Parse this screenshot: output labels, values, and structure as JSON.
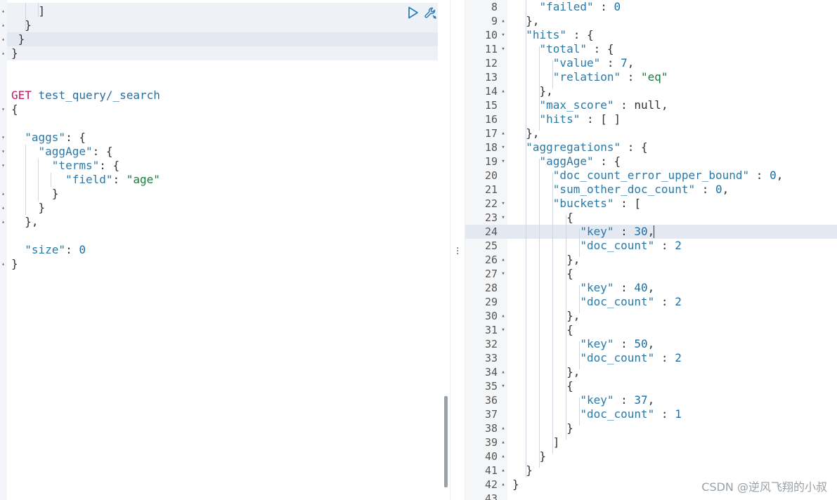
{
  "request_editor": {
    "lines": [
      {
        "tokens": [
          {
            "t": "    ]",
            "c": "p"
          }
        ],
        "fold": "▴"
      },
      {
        "tokens": [
          {
            "t": "  }",
            "c": "p"
          }
        ],
        "fold": "▴"
      },
      {
        "tokens": [
          {
            "t": " }",
            "c": "p"
          }
        ],
        "fold": "▴"
      },
      {
        "tokens": [
          {
            "t": "}",
            "c": "p"
          }
        ],
        "fold": "▴"
      },
      {
        "tokens": [],
        "fold": ""
      },
      {
        "tokens": [],
        "fold": ""
      },
      {
        "tokens": [
          {
            "t": "GET",
            "c": "m"
          },
          {
            "t": " test_query/_search",
            "c": "u"
          }
        ],
        "fold": ""
      },
      {
        "tokens": [
          {
            "t": "{",
            "c": "p"
          }
        ],
        "fold": "▾"
      },
      {
        "tokens": [],
        "fold": ""
      },
      {
        "tokens": [
          {
            "t": "  ",
            "c": "p"
          },
          {
            "t": "\"aggs\"",
            "c": "k"
          },
          {
            "t": ": {",
            "c": "p"
          }
        ],
        "fold": "▾"
      },
      {
        "tokens": [
          {
            "t": "    ",
            "c": "p"
          },
          {
            "t": "\"aggAge\"",
            "c": "k"
          },
          {
            "t": ": {",
            "c": "p"
          }
        ],
        "fold": "▾"
      },
      {
        "tokens": [
          {
            "t": "      ",
            "c": "p"
          },
          {
            "t": "\"terms\"",
            "c": "k"
          },
          {
            "t": ": {",
            "c": "p"
          }
        ],
        "fold": "▾"
      },
      {
        "tokens": [
          {
            "t": "        ",
            "c": "p"
          },
          {
            "t": "\"field\"",
            "c": "k"
          },
          {
            "t": ": ",
            "c": "p"
          },
          {
            "t": "\"age\"",
            "c": "s"
          }
        ],
        "fold": ""
      },
      {
        "tokens": [
          {
            "t": "      }",
            "c": "p"
          }
        ],
        "fold": "▴"
      },
      {
        "tokens": [
          {
            "t": "    }",
            "c": "p"
          }
        ],
        "fold": "▴"
      },
      {
        "tokens": [
          {
            "t": "  },",
            "c": "p"
          }
        ],
        "fold": "▴"
      },
      {
        "tokens": [],
        "fold": ""
      },
      {
        "tokens": [
          {
            "t": "  ",
            "c": "p"
          },
          {
            "t": "\"size\"",
            "c": "k"
          },
          {
            "t": ": ",
            "c": "p"
          },
          {
            "t": "0",
            "c": "n"
          }
        ],
        "fold": ""
      },
      {
        "tokens": [
          {
            "t": "}",
            "c": "p"
          }
        ],
        "fold": "▴"
      }
    ]
  },
  "response_viewer": {
    "lines": [
      {
        "no": "8",
        "fold": "",
        "tokens": [
          {
            "t": "    ",
            "c": "p"
          },
          {
            "t": "\"failed\"",
            "c": "k"
          },
          {
            "t": " : ",
            "c": "p"
          },
          {
            "t": "0",
            "c": "n"
          }
        ]
      },
      {
        "no": "9",
        "fold": "▴",
        "tokens": [
          {
            "t": "  },",
            "c": "p"
          }
        ]
      },
      {
        "no": "10",
        "fold": "▾",
        "tokens": [
          {
            "t": "  ",
            "c": "p"
          },
          {
            "t": "\"hits\"",
            "c": "k"
          },
          {
            "t": " : {",
            "c": "p"
          }
        ]
      },
      {
        "no": "11",
        "fold": "▾",
        "tokens": [
          {
            "t": "    ",
            "c": "p"
          },
          {
            "t": "\"total\"",
            "c": "k"
          },
          {
            "t": " : {",
            "c": "p"
          }
        ]
      },
      {
        "no": "12",
        "fold": "",
        "tokens": [
          {
            "t": "      ",
            "c": "p"
          },
          {
            "t": "\"value\"",
            "c": "k"
          },
          {
            "t": " : ",
            "c": "p"
          },
          {
            "t": "7",
            "c": "n"
          },
          {
            "t": ",",
            "c": "p"
          }
        ]
      },
      {
        "no": "13",
        "fold": "",
        "tokens": [
          {
            "t": "      ",
            "c": "p"
          },
          {
            "t": "\"relation\"",
            "c": "k"
          },
          {
            "t": " : ",
            "c": "p"
          },
          {
            "t": "\"eq\"",
            "c": "s"
          }
        ]
      },
      {
        "no": "14",
        "fold": "▴",
        "tokens": [
          {
            "t": "    },",
            "c": "p"
          }
        ]
      },
      {
        "no": "15",
        "fold": "",
        "tokens": [
          {
            "t": "    ",
            "c": "p"
          },
          {
            "t": "\"max_score\"",
            "c": "k"
          },
          {
            "t": " : ",
            "c": "p"
          },
          {
            "t": "null",
            "c": "nl"
          },
          {
            "t": ",",
            "c": "p"
          }
        ]
      },
      {
        "no": "16",
        "fold": "",
        "tokens": [
          {
            "t": "    ",
            "c": "p"
          },
          {
            "t": "\"hits\"",
            "c": "k"
          },
          {
            "t": " : [ ]",
            "c": "p"
          }
        ]
      },
      {
        "no": "17",
        "fold": "▴",
        "tokens": [
          {
            "t": "  },",
            "c": "p"
          }
        ]
      },
      {
        "no": "18",
        "fold": "▾",
        "tokens": [
          {
            "t": "  ",
            "c": "p"
          },
          {
            "t": "\"aggregations\"",
            "c": "k"
          },
          {
            "t": " : {",
            "c": "p"
          }
        ]
      },
      {
        "no": "19",
        "fold": "▾",
        "tokens": [
          {
            "t": "    ",
            "c": "p"
          },
          {
            "t": "\"aggAge\"",
            "c": "k"
          },
          {
            "t": " : {",
            "c": "p"
          }
        ]
      },
      {
        "no": "20",
        "fold": "",
        "tokens": [
          {
            "t": "      ",
            "c": "p"
          },
          {
            "t": "\"doc_count_error_upper_bound\"",
            "c": "k"
          },
          {
            "t": " : ",
            "c": "p"
          },
          {
            "t": "0",
            "c": "n"
          },
          {
            "t": ",",
            "c": "p"
          }
        ]
      },
      {
        "no": "21",
        "fold": "",
        "tokens": [
          {
            "t": "      ",
            "c": "p"
          },
          {
            "t": "\"sum_other_doc_count\"",
            "c": "k"
          },
          {
            "t": " : ",
            "c": "p"
          },
          {
            "t": "0",
            "c": "n"
          },
          {
            "t": ",",
            "c": "p"
          }
        ]
      },
      {
        "no": "22",
        "fold": "▾",
        "tokens": [
          {
            "t": "      ",
            "c": "p"
          },
          {
            "t": "\"buckets\"",
            "c": "k"
          },
          {
            "t": " : [",
            "c": "p"
          }
        ]
      },
      {
        "no": "23",
        "fold": "▾",
        "tokens": [
          {
            "t": "        {",
            "c": "p"
          }
        ]
      },
      {
        "no": "24",
        "fold": "",
        "tokens": [
          {
            "t": "          ",
            "c": "p"
          },
          {
            "t": "\"key\"",
            "c": "k"
          },
          {
            "t": " : ",
            "c": "p"
          },
          {
            "t": "30",
            "c": "n"
          },
          {
            "t": ",",
            "c": "p"
          }
        ]
      },
      {
        "no": "25",
        "fold": "",
        "tokens": [
          {
            "t": "          ",
            "c": "p"
          },
          {
            "t": "\"doc_count\"",
            "c": "k"
          },
          {
            "t": " : ",
            "c": "p"
          },
          {
            "t": "2",
            "c": "n"
          }
        ]
      },
      {
        "no": "26",
        "fold": "▴",
        "tokens": [
          {
            "t": "        },",
            "c": "p"
          }
        ]
      },
      {
        "no": "27",
        "fold": "▾",
        "tokens": [
          {
            "t": "        {",
            "c": "p"
          }
        ]
      },
      {
        "no": "28",
        "fold": "",
        "tokens": [
          {
            "t": "          ",
            "c": "p"
          },
          {
            "t": "\"key\"",
            "c": "k"
          },
          {
            "t": " : ",
            "c": "p"
          },
          {
            "t": "40",
            "c": "n"
          },
          {
            "t": ",",
            "c": "p"
          }
        ]
      },
      {
        "no": "29",
        "fold": "",
        "tokens": [
          {
            "t": "          ",
            "c": "p"
          },
          {
            "t": "\"doc_count\"",
            "c": "k"
          },
          {
            "t": " : ",
            "c": "p"
          },
          {
            "t": "2",
            "c": "n"
          }
        ]
      },
      {
        "no": "30",
        "fold": "▴",
        "tokens": [
          {
            "t": "        },",
            "c": "p"
          }
        ]
      },
      {
        "no": "31",
        "fold": "▾",
        "tokens": [
          {
            "t": "        {",
            "c": "p"
          }
        ]
      },
      {
        "no": "32",
        "fold": "",
        "tokens": [
          {
            "t": "          ",
            "c": "p"
          },
          {
            "t": "\"key\"",
            "c": "k"
          },
          {
            "t": " : ",
            "c": "p"
          },
          {
            "t": "50",
            "c": "n"
          },
          {
            "t": ",",
            "c": "p"
          }
        ]
      },
      {
        "no": "33",
        "fold": "",
        "tokens": [
          {
            "t": "          ",
            "c": "p"
          },
          {
            "t": "\"doc_count\"",
            "c": "k"
          },
          {
            "t": " : ",
            "c": "p"
          },
          {
            "t": "2",
            "c": "n"
          }
        ]
      },
      {
        "no": "34",
        "fold": "▴",
        "tokens": [
          {
            "t": "        },",
            "c": "p"
          }
        ]
      },
      {
        "no": "35",
        "fold": "▾",
        "tokens": [
          {
            "t": "        {",
            "c": "p"
          }
        ]
      },
      {
        "no": "36",
        "fold": "",
        "tokens": [
          {
            "t": "          ",
            "c": "p"
          },
          {
            "t": "\"key\"",
            "c": "k"
          },
          {
            "t": " : ",
            "c": "p"
          },
          {
            "t": "37",
            "c": "n"
          },
          {
            "t": ",",
            "c": "p"
          }
        ]
      },
      {
        "no": "37",
        "fold": "",
        "tokens": [
          {
            "t": "          ",
            "c": "p"
          },
          {
            "t": "\"doc_count\"",
            "c": "k"
          },
          {
            "t": " : ",
            "c": "p"
          },
          {
            "t": "1",
            "c": "n"
          }
        ]
      },
      {
        "no": "38",
        "fold": "▴",
        "tokens": [
          {
            "t": "        }",
            "c": "p"
          }
        ]
      },
      {
        "no": "39",
        "fold": "▴",
        "tokens": [
          {
            "t": "      ]",
            "c": "p"
          }
        ]
      },
      {
        "no": "40",
        "fold": "▴",
        "tokens": [
          {
            "t": "    }",
            "c": "p"
          }
        ]
      },
      {
        "no": "41",
        "fold": "▴",
        "tokens": [
          {
            "t": "  }",
            "c": "p"
          }
        ]
      },
      {
        "no": "42",
        "fold": "▴",
        "tokens": [
          {
            "t": "}",
            "c": "p"
          }
        ]
      },
      {
        "no": "43",
        "fold": "",
        "tokens": []
      }
    ]
  },
  "icons": {
    "run": "play-icon",
    "settings": "wrench-icon",
    "divider": "vertical-ellipsis-icon"
  },
  "colors": {
    "key": "#2c79a6",
    "string": "#1b7a3e",
    "number": "#1a6fa8",
    "method": "#c2185b",
    "active_line": "#e3e8f1"
  },
  "watermark": "CSDN @逆风飞翔的小叔"
}
